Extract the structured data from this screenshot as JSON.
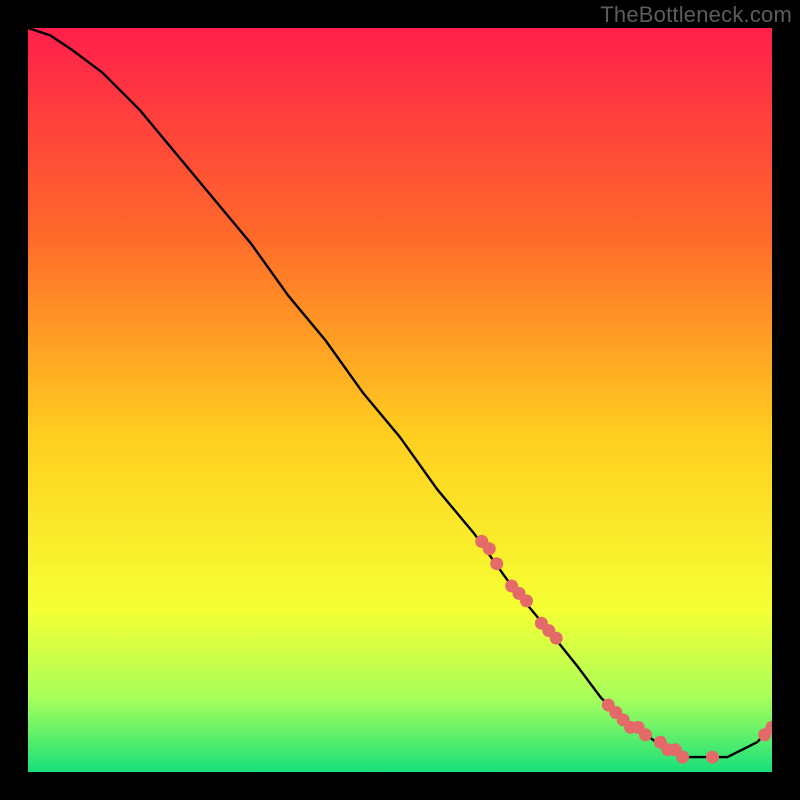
{
  "watermark": "TheBottleneck.com",
  "colors": {
    "gradient_top": "#ff1f4b",
    "gradient_upper_mid": "#ff6a2a",
    "gradient_mid": "#ffcf1f",
    "gradient_lower_mid": "#f6ff33",
    "gradient_low": "#a8ff5a",
    "gradient_bottom": "#18e07a",
    "curve": "#000000",
    "marker": "#e46a6a",
    "frame": "#000000"
  },
  "chart_data": {
    "type": "line",
    "title": "",
    "xlabel": "",
    "ylabel": "",
    "xlim": [
      0,
      100
    ],
    "ylim": [
      0,
      100
    ],
    "series": [
      {
        "name": "bottleneck-curve",
        "x": [
          0,
          3,
          6,
          10,
          15,
          20,
          25,
          30,
          35,
          40,
          45,
          50,
          55,
          60,
          65,
          70,
          74,
          77,
          80,
          83,
          86,
          88,
          90,
          92,
          94,
          96,
          98,
          100
        ],
        "y": [
          100,
          99,
          97,
          94,
          89,
          83,
          77,
          71,
          64,
          58,
          51,
          45,
          38,
          32,
          25,
          19,
          14,
          10,
          7,
          5,
          3,
          2,
          2,
          2,
          2,
          3,
          4,
          6
        ]
      }
    ],
    "markers": {
      "name": "highlighted-points",
      "x": [
        61,
        62,
        63,
        65,
        66,
        67,
        69,
        70,
        71,
        78,
        79,
        80,
        81,
        82,
        83,
        85,
        86,
        87,
        88,
        92,
        99,
        100
      ],
      "y": [
        31,
        30,
        28,
        25,
        24,
        23,
        20,
        19,
        18,
        9,
        8,
        7,
        6,
        6,
        5,
        4,
        3,
        3,
        2,
        2,
        5,
        6
      ]
    }
  }
}
